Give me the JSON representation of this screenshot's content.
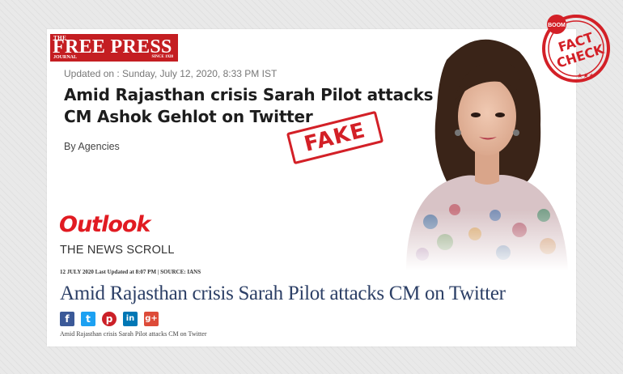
{
  "free_press": {
    "the": "THE",
    "name": "FREE PRESS",
    "journal": "JOURNAL",
    "since": "SINCE 1928",
    "updated": "Updated on : Sunday, July 12, 2020, 8:33 PM IST",
    "headline_line1": "Amid Rajasthan crisis Sarah Pilot attacks",
    "headline_line2": "CM Ashok Gehlot on Twitter",
    "byline": "By Agencies"
  },
  "stamp": {
    "text": "FAKE"
  },
  "outlook": {
    "logo": "Outlook",
    "section": "THE NEWS SCROLL",
    "meta": "12 JULY 2020  Last Updated at 8:07 PM | SOURCE: IANS",
    "headline": "Amid Rajasthan crisis Sarah Pilot attacks CM on Twitter",
    "caption": "Amid Rajasthan crisis Sarah Pilot attacks CM on Twitter",
    "share_icons": [
      "f",
      "t",
      "p",
      "in",
      "g+"
    ]
  },
  "badge": {
    "brand": "BOOM",
    "line1": "FACT",
    "line2": "CHECK"
  },
  "colors": {
    "accent_red": "#d32027",
    "outlook_red": "#e11b22",
    "headline_blue": "#2c3f66",
    "facebook": "#3b5998",
    "twitter": "#1da1f2",
    "pinterest": "#cb2027",
    "linkedin": "#0077b5",
    "googleplus": "#dd4b39"
  }
}
